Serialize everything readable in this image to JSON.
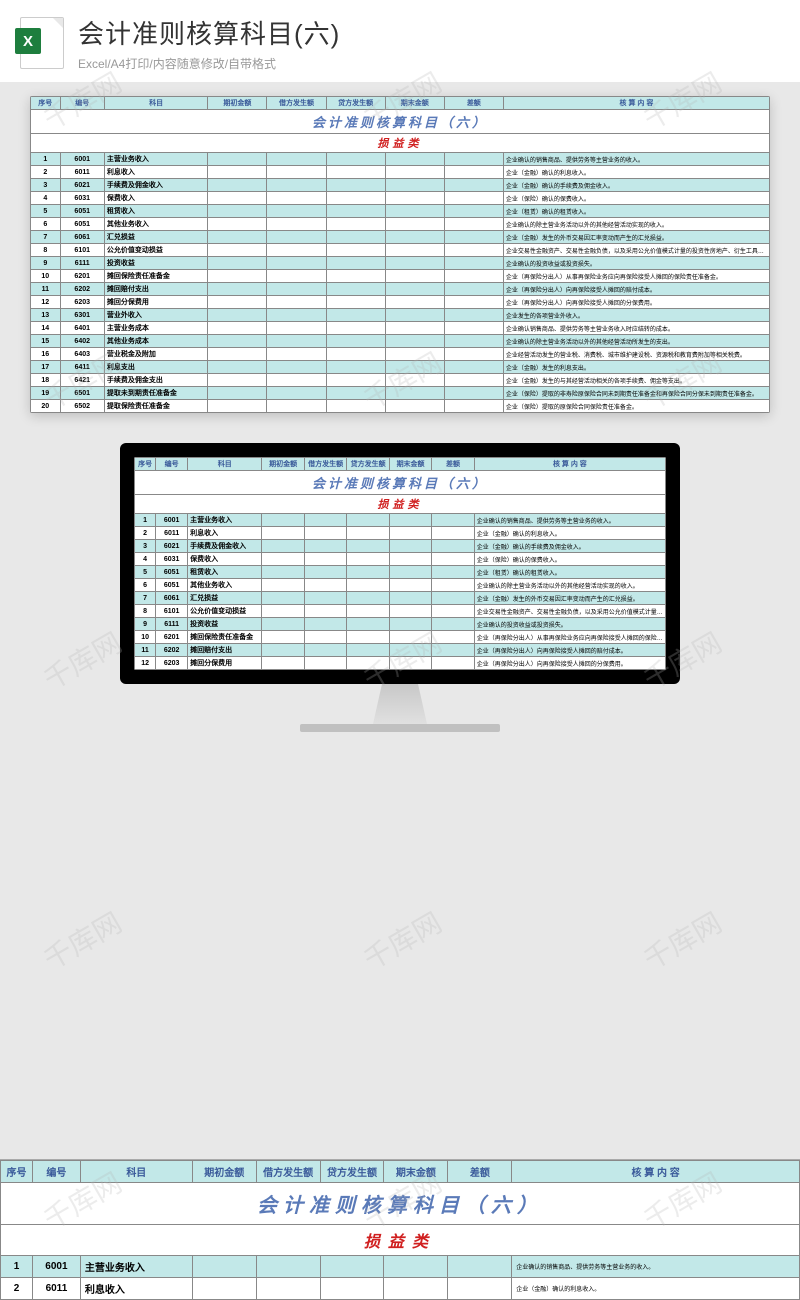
{
  "header": {
    "main_title": "会计准则核算科目(六)",
    "sub_title": "Excel/A4打印/内容随意修改/自带格式"
  },
  "sheet": {
    "title": "会计准则核算科目（六）",
    "subtitle": "损益类",
    "columns": [
      "序号",
      "编号",
      "科目",
      "期初金额",
      "借方发生额",
      "贷方发生额",
      "期末金额",
      "差额",
      "核 算 内 容"
    ],
    "rows": [
      {
        "seq": "1",
        "code": "6001",
        "subject": "主营业务收入",
        "desc": "企业确认的销售商品、提供劳务等主营业务的收入。"
      },
      {
        "seq": "2",
        "code": "6011",
        "subject": "利息收入",
        "desc": "企业（金融）确认的利息收入。"
      },
      {
        "seq": "3",
        "code": "6021",
        "subject": "手续费及佣金收入",
        "desc": "企业（金融）确认的手续费及佣金收入。"
      },
      {
        "seq": "4",
        "code": "6031",
        "subject": "保费收入",
        "desc": "企业（保险）确认的保费收入。"
      },
      {
        "seq": "5",
        "code": "6051",
        "subject": "租赁收入",
        "desc": "企业（租赁）确认的租赁收入。"
      },
      {
        "seq": "6",
        "code": "6051",
        "subject": "其他业务收入",
        "desc": "企业确认的除主营业务活动以外的其他经营活动实现的收入。"
      },
      {
        "seq": "7",
        "code": "6061",
        "subject": "汇兑损益",
        "desc": "企业（金融）发生的外币交易因汇率变动而产生的汇兑损益。"
      },
      {
        "seq": "8",
        "code": "6101",
        "subject": "公允价值变动损益",
        "desc": "企业交易性金融资产、交易性金融负债，以及采用公允价值模式计量的投资性房地产、衍生工具、套期保值业务等公允价值变动形成的应计入当期损益的利得或损失。"
      },
      {
        "seq": "9",
        "code": "6111",
        "subject": "投资收益",
        "desc": "企业确认的投资收益或投资损失。"
      },
      {
        "seq": "10",
        "code": "6201",
        "subject": "摊回保险责任准备金",
        "desc": "企业（再保险分出人）从事再保险业务应向再保险接受人摊回的保险责任准备金。"
      },
      {
        "seq": "11",
        "code": "6202",
        "subject": "摊回赔付支出",
        "desc": "企业（再保险分出人）向再保险接受人摊回的赔付成本。"
      },
      {
        "seq": "12",
        "code": "6203",
        "subject": "摊回分保费用",
        "desc": "企业（再保险分出人）向再保险接受人摊回的分保费用。"
      },
      {
        "seq": "13",
        "code": "6301",
        "subject": "营业外收入",
        "desc": "企业发生的各项营业外收入。"
      },
      {
        "seq": "14",
        "code": "6401",
        "subject": "主营业务成本",
        "desc": "企业确认销售商品、提供劳务等主营业务收入时应结转的成本。"
      },
      {
        "seq": "15",
        "code": "6402",
        "subject": "其他业务成本",
        "desc": "企业确认的除主营业务活动以外的其他经营活动所发生的支出。"
      },
      {
        "seq": "16",
        "code": "6403",
        "subject": "营业税金及附加",
        "desc": "企业经营活动发生的营业税、消费税、城市维护建设税、资源税和教育费附加等相关税费。"
      },
      {
        "seq": "17",
        "code": "6411",
        "subject": "利息支出",
        "desc": "企业（金融）发生的利息支出。"
      },
      {
        "seq": "18",
        "code": "6421",
        "subject": "手续费及佣金支出",
        "desc": "企业（金融）发生的与其经营活动相关的各项手续费、佣金等支出。"
      },
      {
        "seq": "19",
        "code": "6501",
        "subject": "提取未到期责任准备金",
        "desc": "企业（保险）提取的非寿险原保险合同未到期责任准备金和再保险合同分保未到期责任准备金。"
      },
      {
        "seq": "20",
        "code": "6502",
        "subject": "提取保险责任准备金",
        "desc": "企业（保险）提取的原保险合同保险责任准备金。"
      }
    ]
  },
  "watermark_text": "千库网"
}
